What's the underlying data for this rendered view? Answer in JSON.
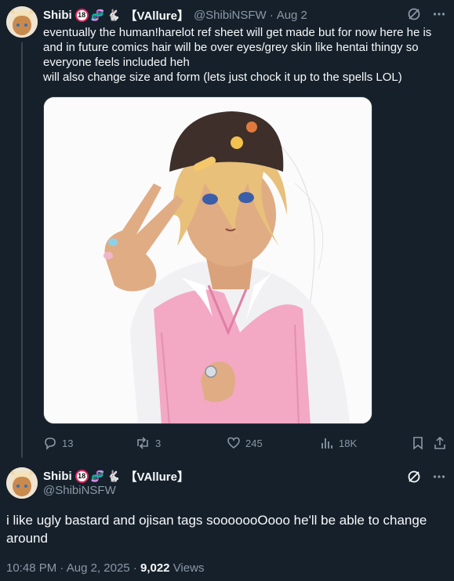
{
  "tweet1": {
    "display_name": "Shibi",
    "badge": "18",
    "emoji_1": "🧬",
    "emoji_2": "🐇",
    "tag": "【VAllure】",
    "handle": "@ShibiNSFW",
    "separator": "·",
    "date": "Aug 2",
    "text": "eventually the human!harelot ref sheet will get made but for now here he is and in future comics hair will be over eyes/grey skin like hentai thingy so everyone feels included heh\nwill also change size and form (lets just chock it up to the spells LOL)",
    "stats": {
      "replies": "13",
      "retweets": "3",
      "likes": "245",
      "views": "18K"
    }
  },
  "tweet2": {
    "display_name": "Shibi",
    "badge": "18",
    "emoji_1": "🧬",
    "emoji_2": "🐇",
    "tag": "【VAllure】",
    "handle": "@ShibiNSFW",
    "text": "i like ugly bastard and ojisan tags sooooooOooo he'll be able to change around",
    "time": "10:48 PM",
    "date": "Aug 2, 2025",
    "separator": "·",
    "views_count": "9,022",
    "views_label": "Views"
  },
  "colors": {
    "background": "#15202b",
    "text": "#f7f9f9",
    "muted": "#8b98a5",
    "badge_red": "#e0245e"
  }
}
